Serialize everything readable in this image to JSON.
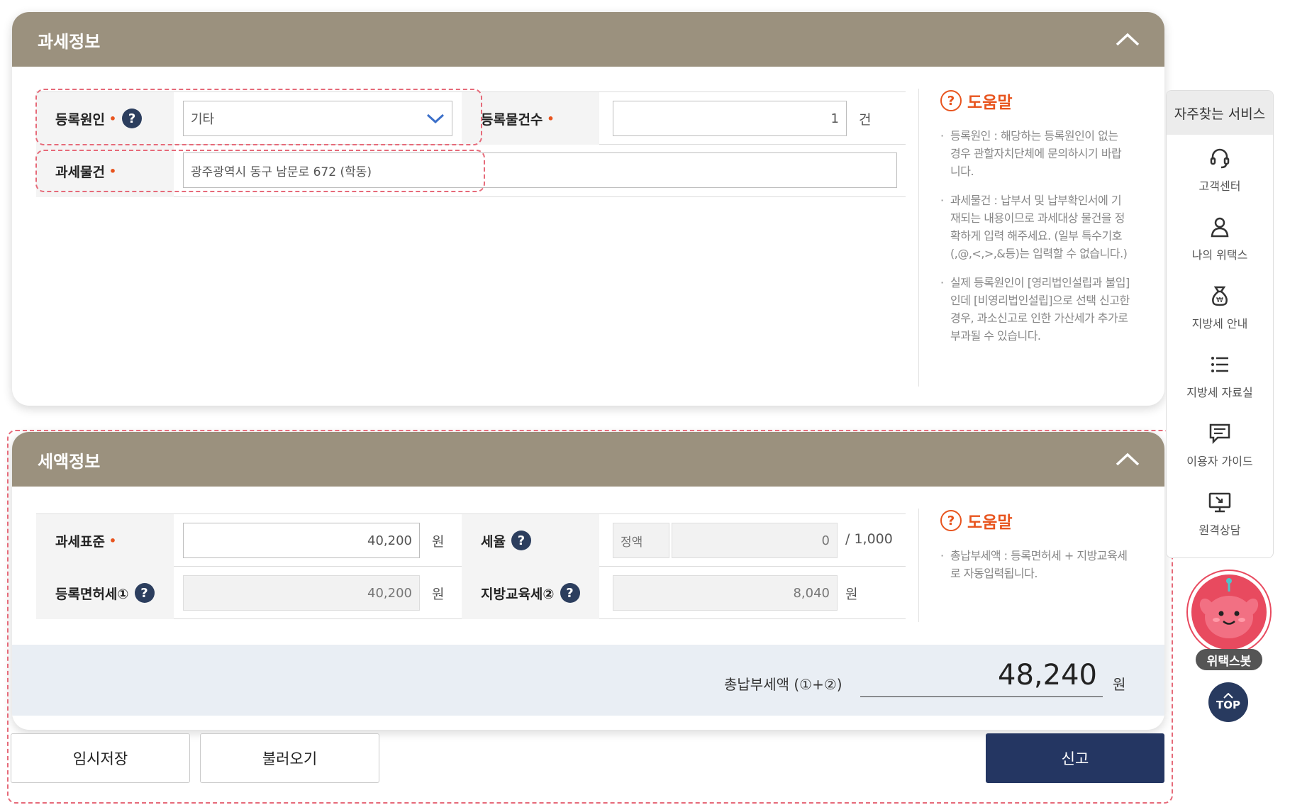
{
  "tax_info": {
    "title": "과세정보",
    "reg_cause_label": "등록원인",
    "reg_cause_value": "기타",
    "reg_count_label": "등록물건수",
    "reg_count_value": "1",
    "reg_count_unit": "건",
    "tax_object_label": "과세물건",
    "tax_object_value": "광주광역시 동구 남문로 672 (학동)",
    "help_title": "도움말",
    "help_items": [
      "등록원인 : 해당하는 등록원인이 없는 경우 관할자치단체에 문의하시기 바랍니다.",
      "과세물건 : 납부서 및 납부확인서에 기재되는 내용이므로 과세대상 물건을 정확하게 입력 해주세요. (일부 특수기호 (,@,<,>,&등)는 입력할 수 없습니다.)",
      "실제 등록원인이 [영리법인설립과 불입]인데 [비영리법인설립]으로 선택 신고한 경우, 과소신고로 인한 가산세가 추가로 부과될 수 있습니다."
    ]
  },
  "tax_amount": {
    "title": "세액정보",
    "base_label": "과세표준",
    "base_value": "40,200",
    "base_unit": "원",
    "rate_label": "세율",
    "rate_type": "정액",
    "rate_value": "0",
    "rate_unit": "/ 1,000",
    "reg_tax_label": "등록면허세①",
    "reg_tax_value": "40,200",
    "reg_tax_unit": "원",
    "edu_tax_label": "지방교육세②",
    "edu_tax_value": "8,040",
    "edu_tax_unit": "원",
    "help_title": "도움말",
    "help_items": [
      "총납부세액 : 등록면허세 + 지방교육세로 자동입력됩니다."
    ],
    "total_label": "총납부세액 (①+②)",
    "total_value": "48,240",
    "total_unit": "원"
  },
  "buttons": {
    "temp_save": "임시저장",
    "load": "불러오기",
    "submit": "신고"
  },
  "sidebar": {
    "title": "자주찾는 서비스",
    "items": [
      {
        "label": "고객센터",
        "icon": "headset-icon"
      },
      {
        "label": "나의 위택스",
        "icon": "user-icon"
      },
      {
        "label": "지방세 안내",
        "icon": "money-bag-icon"
      },
      {
        "label": "지방세 자료실",
        "icon": "list-icon"
      },
      {
        "label": "이용자 가이드",
        "icon": "chat-icon"
      },
      {
        "label": "원격상담",
        "icon": "monitor-icon"
      }
    ]
  },
  "chatbot": {
    "label": "위택스봇"
  },
  "top_button": {
    "label": "TOP"
  },
  "qmark_glyph": "?",
  "help_glyph": "?"
}
